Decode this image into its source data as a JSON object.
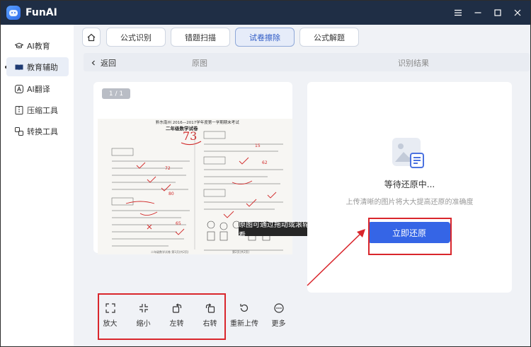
{
  "app": {
    "name": "FunAI"
  },
  "window_controls": [
    "menu-icon",
    "minimize-icon",
    "maximize-icon",
    "close-icon"
  ],
  "sidebar": {
    "items": [
      {
        "label": "AI教育",
        "icon": "graduation-cap-icon"
      },
      {
        "label": "教育辅助",
        "icon": "book-icon",
        "active": true
      },
      {
        "label": "AI翻译",
        "icon": "translate-icon"
      },
      {
        "label": "压缩工具",
        "icon": "compress-icon"
      },
      {
        "label": "转换工具",
        "icon": "convert-icon"
      }
    ]
  },
  "tabs": {
    "home_icon": "home-icon",
    "items": [
      {
        "label": "公式识别"
      },
      {
        "label": "错题扫描"
      },
      {
        "label": "试卷擦除",
        "active": true
      },
      {
        "label": "公式解题"
      }
    ]
  },
  "subbar": {
    "back_label": "返回",
    "original_label": "原图",
    "result_label": "识别结果"
  },
  "preview": {
    "page_indicator": "1 / 1",
    "tooltip": "原图可通过拖动或滚轮缩放查看",
    "exam": {
      "header": "黔东南州 2016—2017学年度第一学期期末考试",
      "title": "二年级数学试卷",
      "score": "73"
    }
  },
  "result": {
    "status": "等待还原中...",
    "tip": "上传清晰的图片将大大提高还原的准确度",
    "button_label": "立即还原"
  },
  "toolbar": {
    "items": [
      {
        "label": "放大",
        "icon": "zoom-in-icon"
      },
      {
        "label": "缩小",
        "icon": "zoom-out-icon"
      },
      {
        "label": "左转",
        "icon": "rotate-left-icon"
      },
      {
        "label": "右转",
        "icon": "rotate-right-icon"
      },
      {
        "label": "重新上传",
        "icon": "reupload-icon"
      },
      {
        "label": "更多",
        "icon": "more-icon"
      }
    ]
  },
  "colors": {
    "titlebar": "#1f2e45",
    "accent": "#3565e6",
    "annotation_red": "#d9262c",
    "main_bg": "#f0f2f6"
  }
}
